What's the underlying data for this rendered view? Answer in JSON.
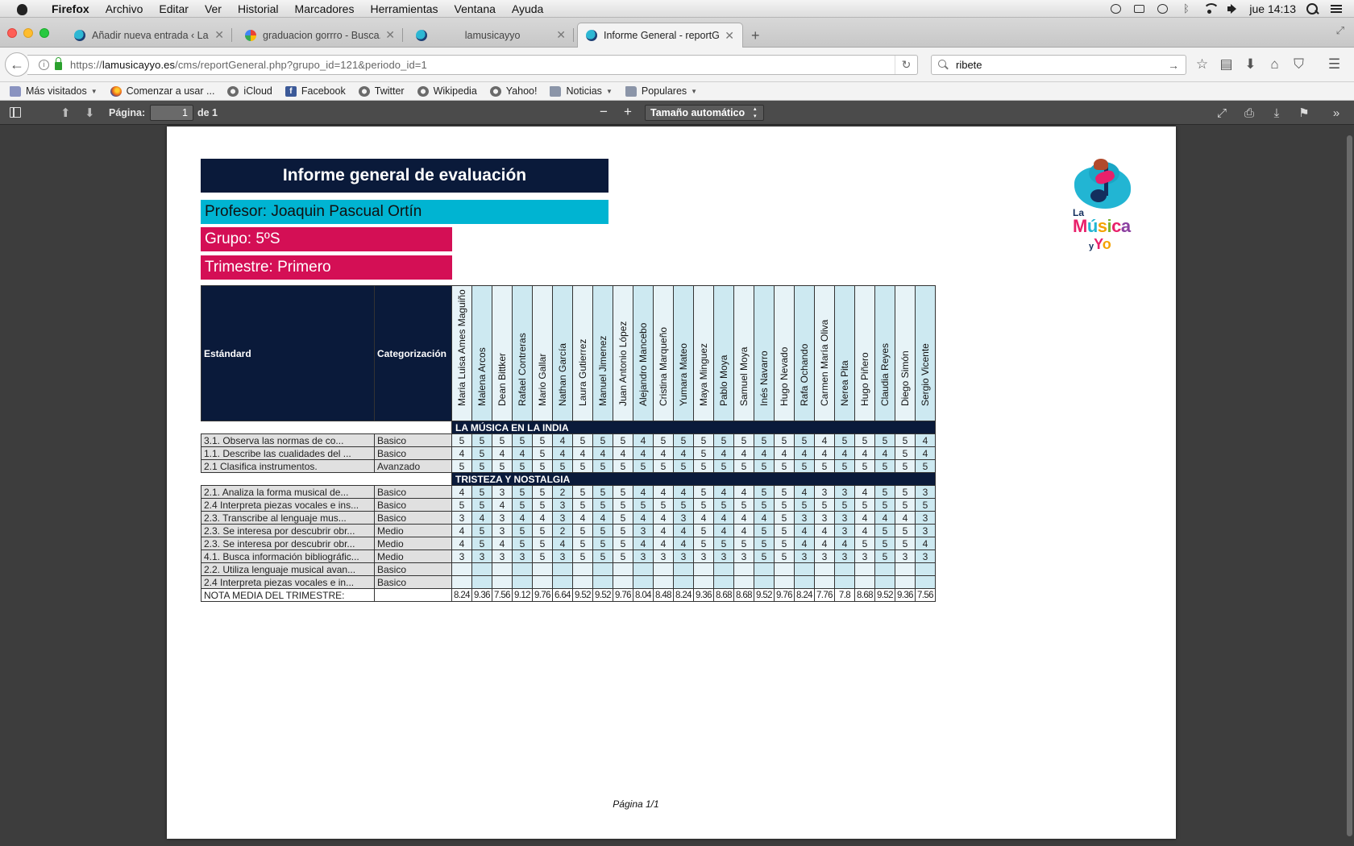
{
  "menubar": {
    "app": "Firefox",
    "items": [
      "Archivo",
      "Editar",
      "Ver",
      "Historial",
      "Marcadores",
      "Herramientas",
      "Ventana",
      "Ayuda"
    ],
    "clock": "jue 14:13"
  },
  "tabs": [
    {
      "title": "Añadir nueva entrada ‹ La ...",
      "favicon": "lamusicayyo-icon"
    },
    {
      "title": "graduacion gorrro - Busca...",
      "favicon": "google-icon"
    },
    {
      "title": "lamusicayyo",
      "favicon": "lamusicayyo-icon"
    },
    {
      "title": "Informe General - reportG...",
      "favicon": "lamusicayyo-icon"
    }
  ],
  "navbar": {
    "url_prefix": "https://",
    "url_host": "lamusicayyo.es",
    "url_path": "/cms/reportGeneral.php?grupo_id=121&periodo_id=1",
    "search_value": "ribete"
  },
  "bookmarks": [
    {
      "label": "Más visitados",
      "icon": "folder-icon",
      "dropdown": true
    },
    {
      "label": "Comenzar a usar ...",
      "icon": "firefox-icon",
      "dropdown": false
    },
    {
      "label": "iCloud",
      "icon": "globe-icon",
      "dropdown": false
    },
    {
      "label": "Facebook",
      "icon": "facebook-icon",
      "dropdown": false
    },
    {
      "label": "Twitter",
      "icon": "globe-icon",
      "dropdown": false
    },
    {
      "label": "Wikipedia",
      "icon": "globe-icon",
      "dropdown": false
    },
    {
      "label": "Yahoo!",
      "icon": "globe-icon",
      "dropdown": false
    },
    {
      "label": "Noticias",
      "icon": "folder-icon",
      "dropdown": true
    },
    {
      "label": "Populares",
      "icon": "folder-icon",
      "dropdown": true
    }
  ],
  "pdf_toolbar": {
    "page_label": "Página:",
    "page_value": "1",
    "page_of": "de 1",
    "zoom_value": "Tamaño automático"
  },
  "report": {
    "title": "Informe general de evaluación",
    "teacher": "Profesor: Joaquin Pascual Ortín",
    "group": "Grupo: 5ºS",
    "term": "Trimestre: Primero",
    "col_standard": "Estándard",
    "col_category": "Categorización",
    "students": [
      "Maria Luisa Ames Maguiño",
      "Malena Arcos",
      "Dean Bittker",
      "Rafael Contreras",
      "Mario Gallar",
      "Nathan García",
      "Laura Gutierrez",
      "Manuel Jimenez",
      "Juan Antonio López",
      "Alejandro Mancebo",
      "Cristina Marqueño",
      "Yumara Mateo",
      "Maya Minguez",
      "Pablo Moya",
      "Samuel Moya",
      "Inés Navarro",
      "Hugo Nevado",
      "Rafa Ochando",
      "Carmen María Oliva",
      "Nerea Pita",
      "Hugo Piñero",
      "Claudia Reyes",
      "Diego Simón",
      "Sergio Vicente"
    ],
    "sections": [
      {
        "name": "LA MÚSICA EN LA INDIA",
        "rows": [
          {
            "standard": "3.1. Observa las normas de co...",
            "category": "Basico",
            "scores": [
              "5",
              "5",
              "5",
              "5",
              "5",
              "4",
              "5",
              "5",
              "5",
              "4",
              "5",
              "5",
              "5",
              "5",
              "5",
              "5",
              "5",
              "5",
              "4",
              "5",
              "5",
              "5",
              "5",
              "4"
            ]
          },
          {
            "standard": "1.1. Describe las cualidades del ...",
            "category": "Basico",
            "scores": [
              "4",
              "5",
              "4",
              "4",
              "5",
              "4",
              "4",
              "4",
              "4",
              "4",
              "4",
              "4",
              "5",
              "4",
              "4",
              "4",
              "4",
              "4",
              "4",
              "4",
              "4",
              "4",
              "5",
              "4"
            ]
          },
          {
            "standard": "2.1 Clasifica instrumentos.",
            "category": "Avanzado",
            "scores": [
              "5",
              "5",
              "5",
              "5",
              "5",
              "5",
              "5",
              "5",
              "5",
              "5",
              "5",
              "5",
              "5",
              "5",
              "5",
              "5",
              "5",
              "5",
              "5",
              "5",
              "5",
              "5",
              "5",
              "5"
            ]
          }
        ]
      },
      {
        "name": "TRISTEZA Y NOSTALGIA",
        "rows": [
          {
            "standard": "2.1.  Analiza la forma musical de...",
            "category": "Basico",
            "scores": [
              "4",
              "5",
              "3",
              "5",
              "5",
              "2",
              "5",
              "5",
              "5",
              "4",
              "4",
              "4",
              "5",
              "4",
              "4",
              "5",
              "5",
              "4",
              "3",
              "3",
              "4",
              "5",
              "5",
              "3"
            ]
          },
          {
            "standard": "2.4 Interpreta piezas vocales e ins...",
            "category": "Basico",
            "scores": [
              "5",
              "5",
              "4",
              "5",
              "5",
              "3",
              "5",
              "5",
              "5",
              "5",
              "5",
              "5",
              "5",
              "5",
              "5",
              "5",
              "5",
              "5",
              "5",
              "5",
              "5",
              "5",
              "5",
              "5"
            ]
          },
          {
            "standard": "2.3.  Transcribe al lenguaje mus...",
            "category": "Basico",
            "scores": [
              "3",
              "4",
              "3",
              "4",
              "4",
              "3",
              "4",
              "4",
              "5",
              "4",
              "4",
              "3",
              "4",
              "4",
              "4",
              "4",
              "5",
              "3",
              "3",
              "3",
              "4",
              "4",
              "4",
              "3"
            ]
          },
          {
            "standard": "2.3. Se interesa por descubrir obr...",
            "category": "Medio",
            "scores": [
              "4",
              "5",
              "3",
              "5",
              "5",
              "2",
              "5",
              "5",
              "5",
              "3",
              "4",
              "4",
              "5",
              "4",
              "4",
              "5",
              "5",
              "4",
              "4",
              "3",
              "4",
              "5",
              "5",
              "3"
            ]
          },
          {
            "standard": "2.3. Se interesa por descubrir obr...",
            "category": "Medio",
            "scores": [
              "4",
              "5",
              "4",
              "5",
              "5",
              "4",
              "5",
              "5",
              "5",
              "4",
              "4",
              "4",
              "5",
              "5",
              "5",
              "5",
              "5",
              "4",
              "4",
              "4",
              "5",
              "5",
              "5",
              "4"
            ]
          },
          {
            "standard": "4.1. Busca información bibliográfic...",
            "category": "Medio",
            "scores": [
              "3",
              "3",
              "3",
              "3",
              "5",
              "3",
              "5",
              "5",
              "5",
              "3",
              "3",
              "3",
              "3",
              "3",
              "3",
              "5",
              "5",
              "3",
              "3",
              "3",
              "3",
              "5",
              "3",
              "3"
            ]
          },
          {
            "standard": "2.2. Utiliza lenguaje musical avan...",
            "category": "Basico",
            "scores": [
              "",
              "",
              "",
              "",
              "",
              "",
              "",
              "",
              "",
              "",
              "",
              "",
              "",
              "",
              "",
              "",
              "",
              "",
              "",
              "",
              "",
              "",
              "",
              ""
            ]
          },
          {
            "standard": "2.4 Interpreta piezas vocales e in...",
            "category": "Basico",
            "scores": [
              "",
              "",
              "",
              "",
              "",
              "",
              "",
              "",
              "",
              "",
              "",
              "",
              "",
              "",
              "",
              "",
              "",
              "",
              "",
              "",
              "",
              "",
              "",
              ""
            ]
          }
        ]
      }
    ],
    "average_label": "NOTA MEDIA DEL TRIMESTRE:",
    "averages": [
      "8.24",
      "9.36",
      "7.56",
      "9.12",
      "9.76",
      "6.64",
      "9.52",
      "9.52",
      "9.76",
      "8.04",
      "8.48",
      "8.24",
      "9.36",
      "8.68",
      "8.68",
      "9.52",
      "9.76",
      "8.24",
      "7.76",
      "7.8",
      "8.68",
      "9.52",
      "9.36",
      "7.56"
    ],
    "footer": "Página 1/1",
    "logo_line1": "La",
    "logo_line2": "Música",
    "logo_line3": "yYo"
  }
}
